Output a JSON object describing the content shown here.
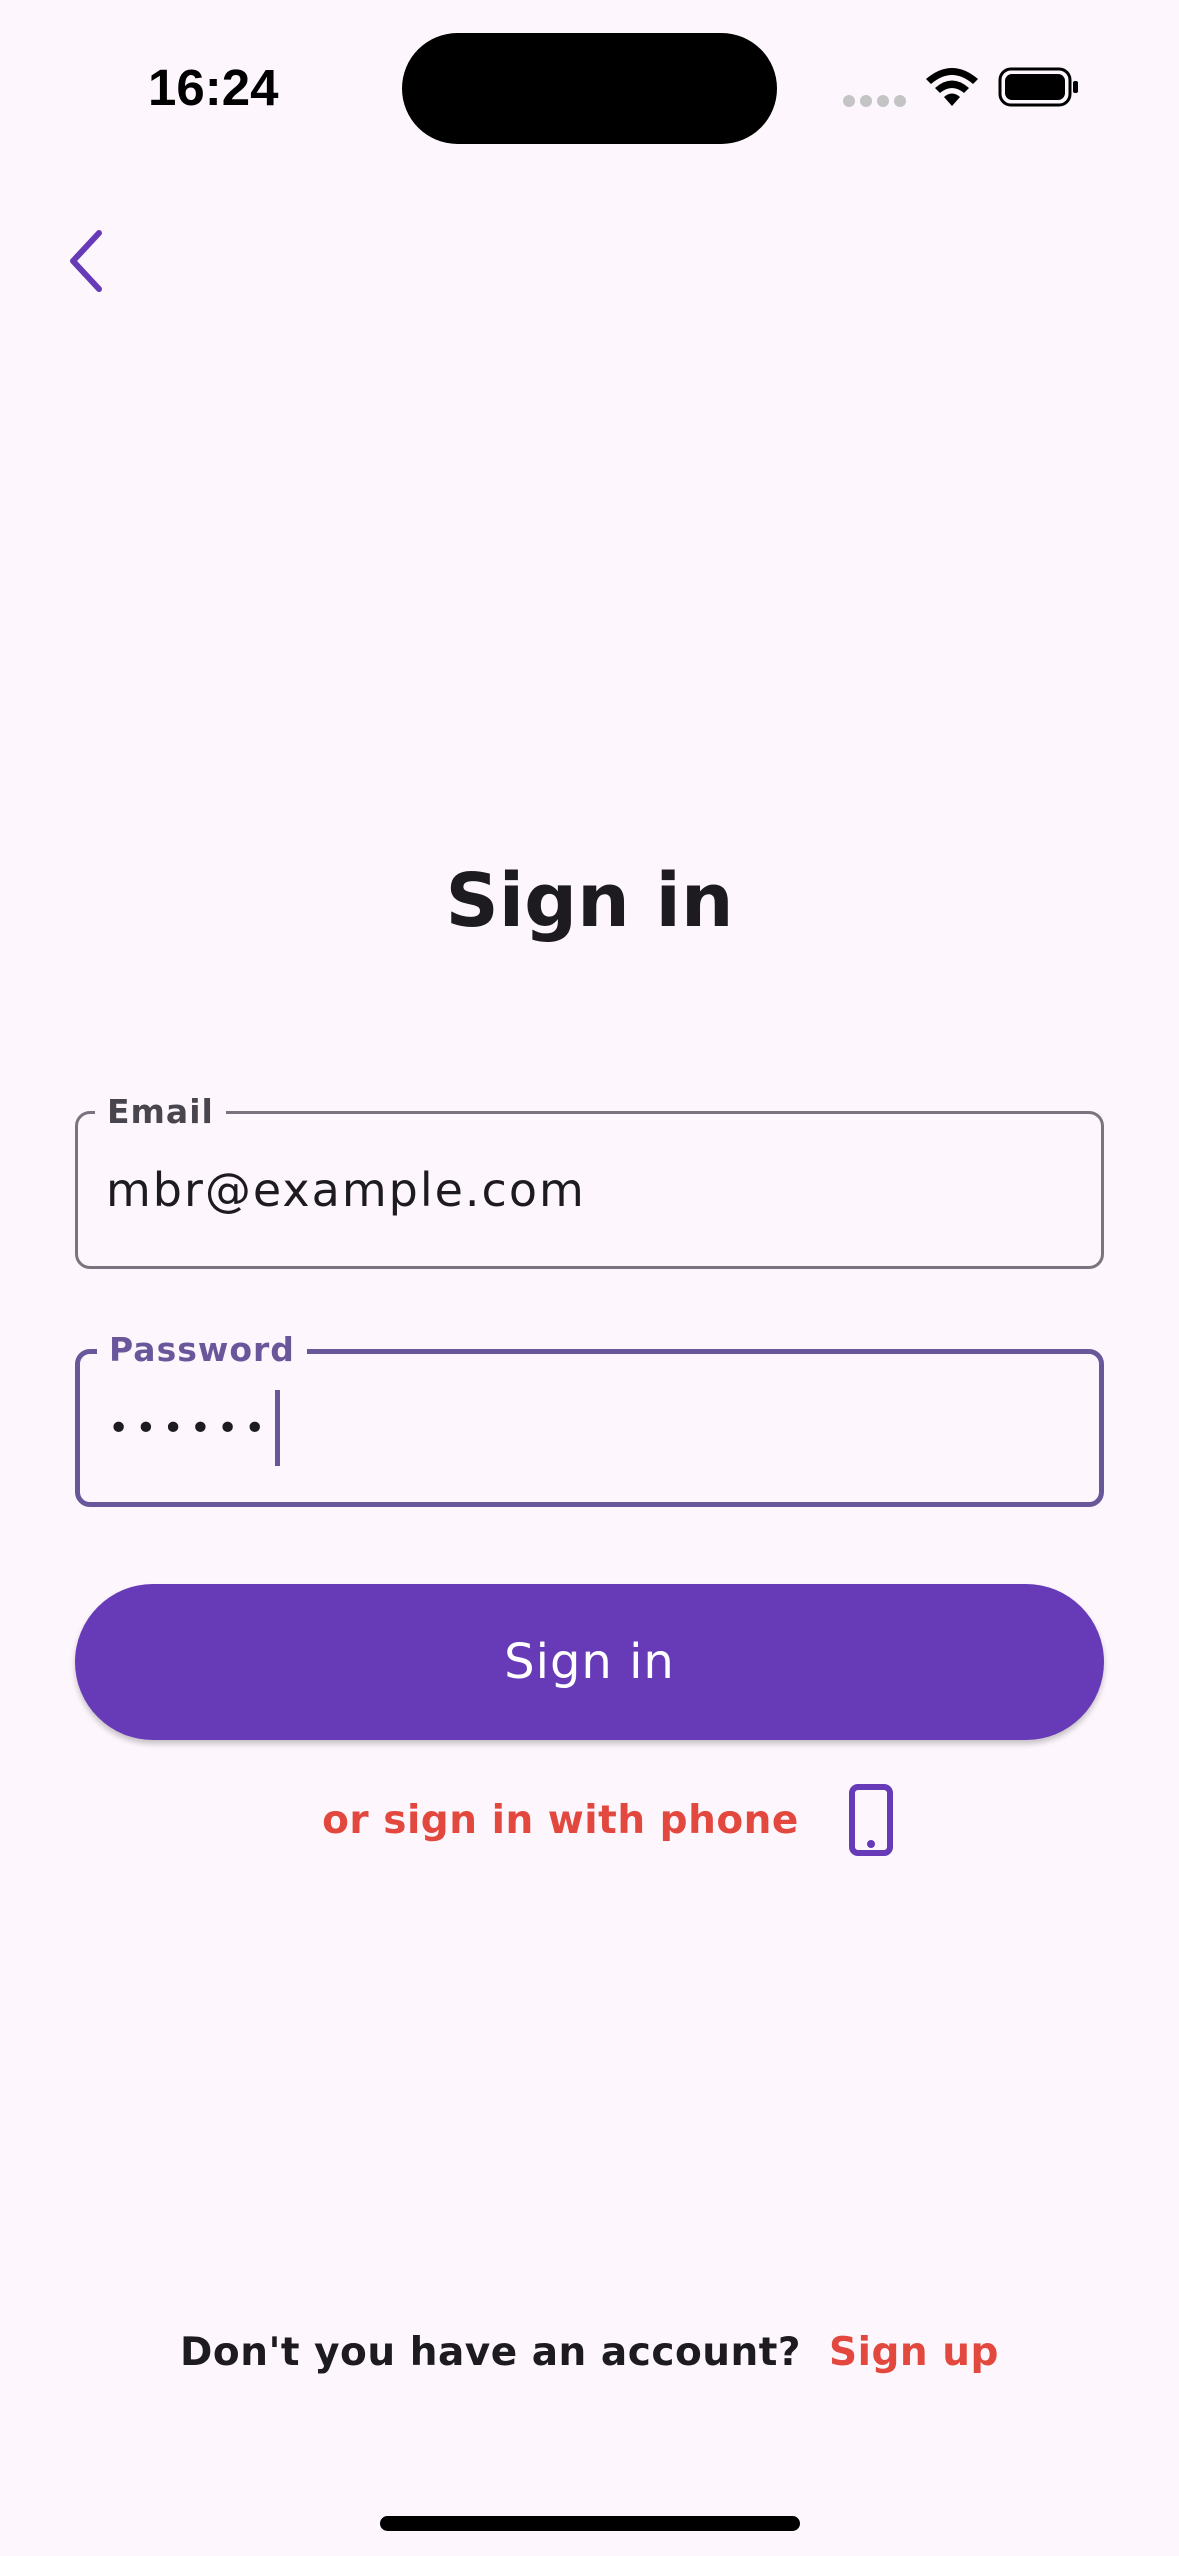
{
  "status_bar": {
    "time": "16:24"
  },
  "header": {
    "back_icon": "chevron-left-icon"
  },
  "title": "Sign in",
  "form": {
    "email": {
      "label": "Email",
      "value": "mbr@example.com"
    },
    "password": {
      "label": "Password",
      "masked_value": "••••••"
    },
    "submit_label": "Sign in"
  },
  "alt_signin": {
    "label": "or sign in with phone",
    "icon": "phone-icon"
  },
  "footer": {
    "prompt": "Don't you have an account?",
    "signup_label": "Sign up"
  },
  "colors": {
    "background": "#fdf7fd",
    "primary": "#673ab7",
    "accent": "#e2483d",
    "focused_outline": "#6a579b",
    "text": "#1d1b20"
  }
}
